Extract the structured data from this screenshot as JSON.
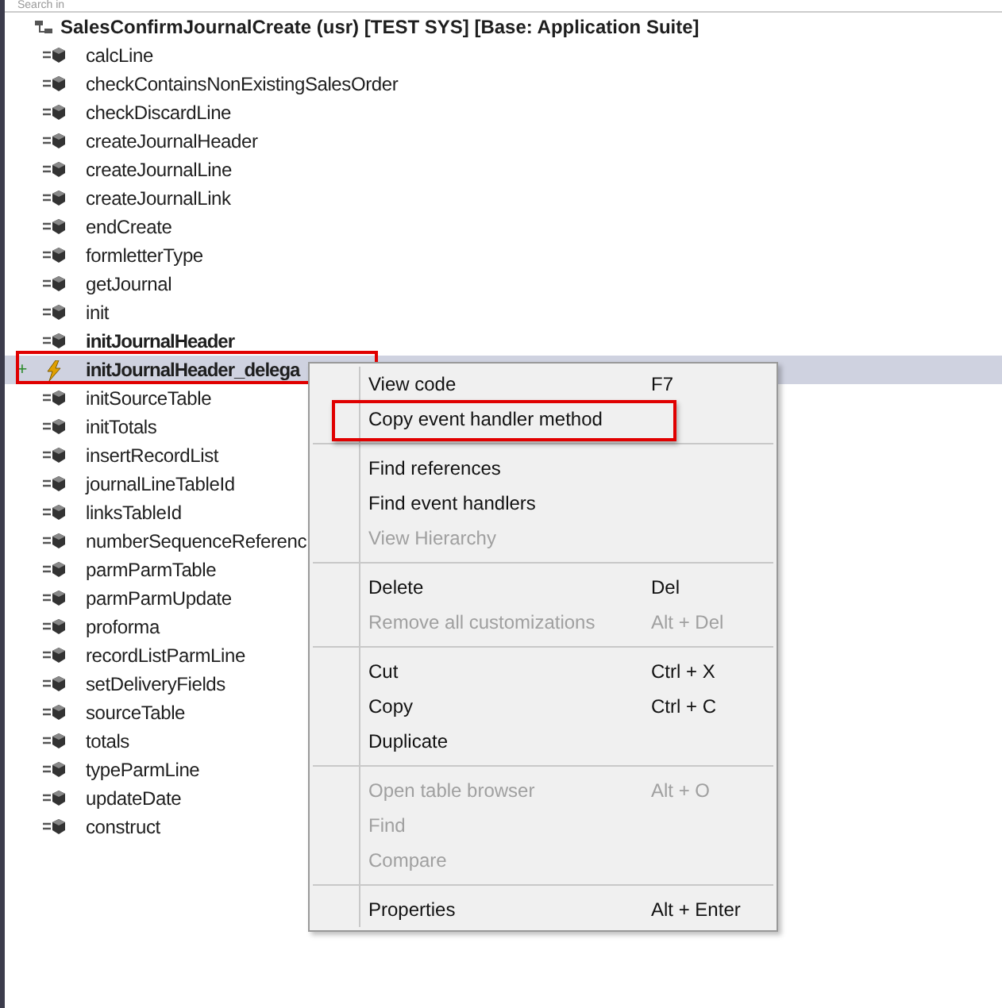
{
  "search": {
    "placeholder": "Search in"
  },
  "tree": {
    "label": "SalesConfirmJournalCreate (usr) [TEST SYS] [Base: Application Suite]",
    "expanded": true,
    "children": [
      {
        "label": "calcLine",
        "kind": "method",
        "bold": false,
        "selected": false
      },
      {
        "label": "checkContainsNonExistingSalesOrder",
        "kind": "method",
        "bold": false,
        "selected": false
      },
      {
        "label": "checkDiscardLine",
        "kind": "method",
        "bold": false,
        "selected": false
      },
      {
        "label": "createJournalHeader",
        "kind": "method",
        "bold": false,
        "selected": false
      },
      {
        "label": "createJournalLine",
        "kind": "method",
        "bold": false,
        "selected": false
      },
      {
        "label": "createJournalLink",
        "kind": "method",
        "bold": false,
        "selected": false
      },
      {
        "label": "endCreate",
        "kind": "method",
        "bold": false,
        "selected": false
      },
      {
        "label": "formletterType",
        "kind": "method",
        "bold": false,
        "selected": false
      },
      {
        "label": "getJournal",
        "kind": "method",
        "bold": false,
        "selected": false
      },
      {
        "label": "init",
        "kind": "method",
        "bold": false,
        "selected": false
      },
      {
        "label": "initJournalHeader",
        "kind": "method",
        "bold": true,
        "selected": false
      },
      {
        "label": "initJournalHeader_delega",
        "kind": "delegate",
        "bold": true,
        "selected": true,
        "expander": "+",
        "annotated": true
      },
      {
        "label": "initSourceTable",
        "kind": "method",
        "bold": false,
        "selected": false
      },
      {
        "label": "initTotals",
        "kind": "method",
        "bold": false,
        "selected": false
      },
      {
        "label": "insertRecordList",
        "kind": "method",
        "bold": false,
        "selected": false
      },
      {
        "label": "journalLineTableId",
        "kind": "method",
        "bold": false,
        "selected": false
      },
      {
        "label": "linksTableId",
        "kind": "method",
        "bold": false,
        "selected": false
      },
      {
        "label": "numberSequenceReferenc",
        "kind": "method",
        "bold": false,
        "selected": false
      },
      {
        "label": "parmParmTable",
        "kind": "method",
        "bold": false,
        "selected": false
      },
      {
        "label": "parmParmUpdate",
        "kind": "method",
        "bold": false,
        "selected": false
      },
      {
        "label": "proforma",
        "kind": "method",
        "bold": false,
        "selected": false
      },
      {
        "label": "recordListParmLine",
        "kind": "method",
        "bold": false,
        "selected": false
      },
      {
        "label": "setDeliveryFields",
        "kind": "method",
        "bold": false,
        "selected": false
      },
      {
        "label": "sourceTable",
        "kind": "method",
        "bold": false,
        "selected": false
      },
      {
        "label": "totals",
        "kind": "method",
        "bold": false,
        "selected": false
      },
      {
        "label": "typeParmLine",
        "kind": "method",
        "bold": false,
        "selected": false
      },
      {
        "label": "updateDate",
        "kind": "method",
        "bold": false,
        "selected": false
      },
      {
        "label": "construct",
        "kind": "method",
        "bold": false,
        "selected": false
      }
    ]
  },
  "context_menu": {
    "groups": [
      [
        {
          "label": "View code",
          "shortcut": "F7",
          "disabled": false,
          "annotated": false
        },
        {
          "label": "Copy event handler method",
          "disabled": false,
          "annotated": true
        }
      ],
      [
        {
          "label": "Find references",
          "disabled": false,
          "annotated": false
        },
        {
          "label": "Find event handlers",
          "disabled": false,
          "annotated": false
        },
        {
          "label": "View Hierarchy",
          "disabled": true,
          "annotated": false
        }
      ],
      [
        {
          "label": "Delete",
          "shortcut": "Del",
          "disabled": false,
          "annotated": false
        },
        {
          "label": "Remove all customizations",
          "shortcut": "Alt + Del",
          "disabled": true,
          "annotated": false
        }
      ],
      [
        {
          "label": "Cut",
          "shortcut": "Ctrl + X",
          "disabled": false,
          "annotated": false
        },
        {
          "label": "Copy",
          "shortcut": "Ctrl + C",
          "disabled": false,
          "annotated": false
        },
        {
          "label": "Duplicate",
          "disabled": false,
          "annotated": false
        }
      ],
      [
        {
          "label": "Open table browser",
          "shortcut": "Alt + O",
          "disabled": true,
          "annotated": false
        },
        {
          "label": "Find",
          "disabled": true,
          "annotated": false
        },
        {
          "label": "Compare",
          "disabled": true,
          "annotated": false
        }
      ],
      [
        {
          "label": "Properties",
          "shortcut": "Alt + Enter",
          "disabled": false,
          "annotated": false
        }
      ]
    ]
  }
}
